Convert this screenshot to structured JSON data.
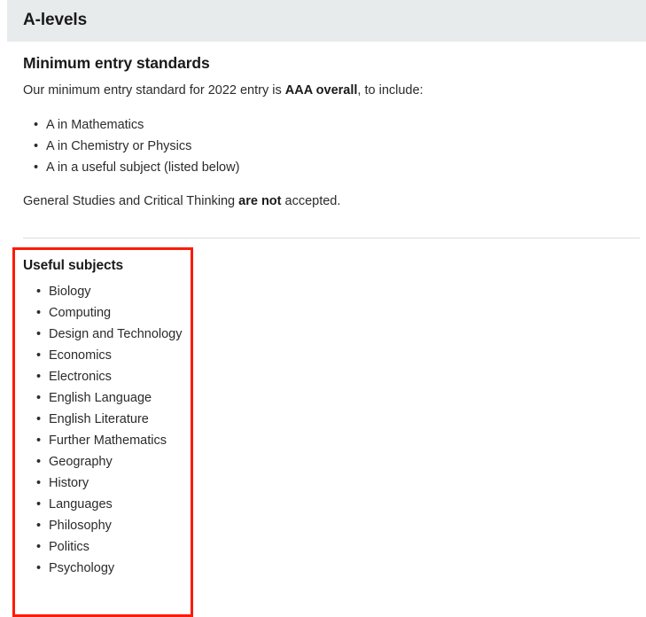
{
  "section": {
    "header_title": "A-levels"
  },
  "main": {
    "subheading": "Minimum entry standards",
    "intro": {
      "before": "Our minimum entry standard for 2022 entry is ",
      "bold": "AAA overall",
      "after": ", to include:"
    },
    "entry_requirements": [
      "A in Mathematics",
      "A in Chemistry or Physics",
      "A in a useful subject (listed below)"
    ],
    "note": {
      "before": "General Studies and Critical Thinking ",
      "bold": "are not",
      "after": " accepted."
    }
  },
  "useful_subjects": {
    "title": "Useful subjects",
    "items": [
      "Biology",
      "Computing",
      "Design and Technology",
      "Economics",
      "Electronics",
      "English Language",
      "English Literature",
      "Further Mathematics",
      "Geography",
      "History",
      "Languages",
      "Philosophy",
      "Politics",
      "Psychology"
    ]
  },
  "colors": {
    "header_background": "#e8ebec",
    "highlight_border": "#fc1b06",
    "body_text": "#2b2b2b",
    "heading_text": "#1a1a1a",
    "divider": "#dcdcdc"
  }
}
